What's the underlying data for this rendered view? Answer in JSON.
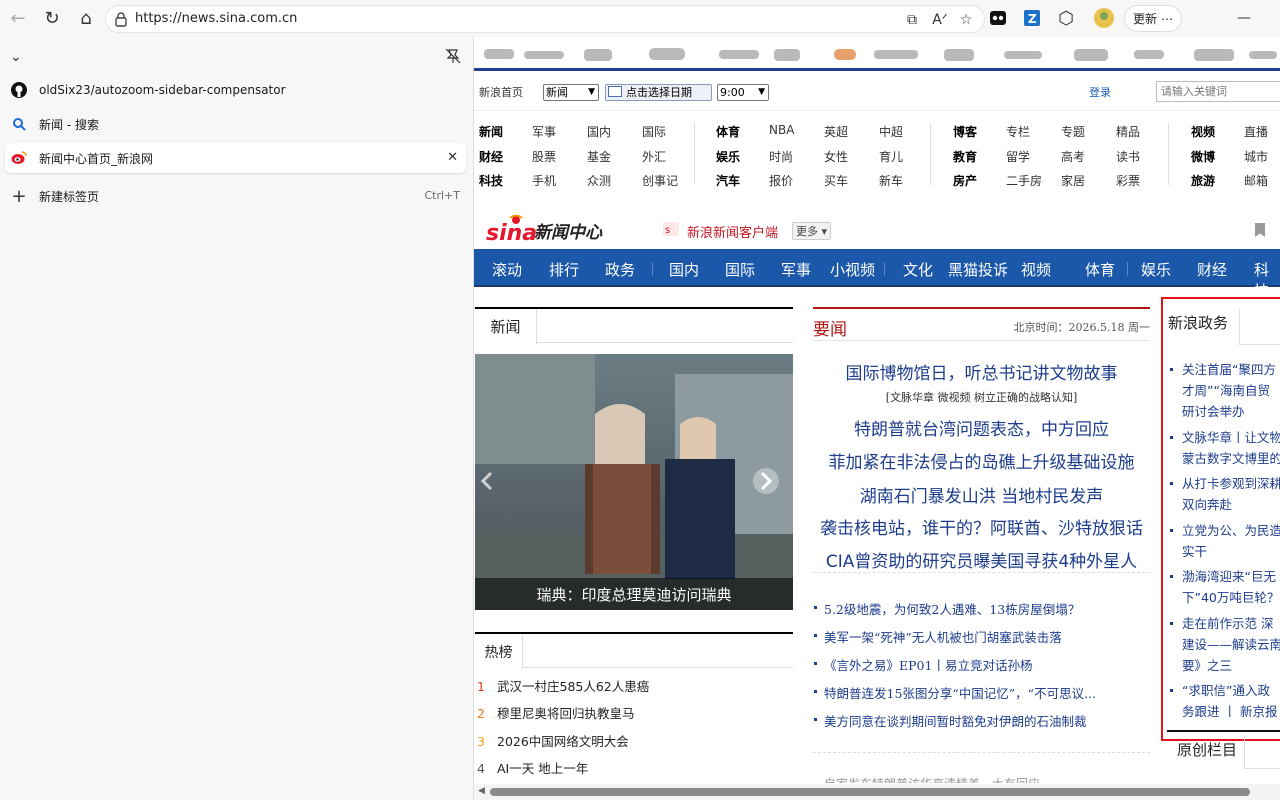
{
  "browser": {
    "url": "https://news.sina.com.cn",
    "update_label": "更新"
  },
  "sidebar": {
    "tabs": [
      {
        "title": "oldSix23/autozoom-sidebar-compensator",
        "icon": "github-icon"
      },
      {
        "title": "新闻 - 搜索",
        "icon": "search-icon"
      },
      {
        "title": "新闻中心首页_新浪网",
        "icon": "weibo-icon",
        "active": true
      },
      {
        "title": "新建标签页",
        "icon": "plus-icon",
        "shortcut": "Ctrl+T"
      }
    ]
  },
  "topbar": {
    "home_link": "新浪首页",
    "channel_select": "新闻",
    "date_placeholder": "点击选择日期",
    "time_select": "9:00",
    "login": "登录",
    "search_placeholder": "请输入关键词"
  },
  "nav": {
    "g1": [
      [
        "新闻",
        "军事",
        "国内",
        "国际"
      ],
      [
        "财经",
        "股票",
        "基金",
        "外汇"
      ],
      [
        "科技",
        "手机",
        "众测",
        "创事记"
      ]
    ],
    "g2": [
      [
        "体育",
        "NBA",
        "英超",
        "中超"
      ],
      [
        "娱乐",
        "时尚",
        "女性",
        "育儿"
      ],
      [
        "汽车",
        "报价",
        "买车",
        "新车"
      ]
    ],
    "g3": [
      [
        "博客",
        "专栏",
        "专题",
        "精品"
      ],
      [
        "教育",
        "留学",
        "高考",
        "读书"
      ],
      [
        "房产",
        "二手房",
        "家居",
        "彩票"
      ]
    ],
    "g4": [
      [
        "视频",
        "直播"
      ],
      [
        "微博",
        "城市"
      ],
      [
        "旅游",
        "邮箱"
      ]
    ]
  },
  "logo": {
    "brand": "sina",
    "title": "新闻中心"
  },
  "client_link": "新浪新闻客户端",
  "more_label": "更多",
  "channel_bar": [
    "滚动",
    "排行",
    "政务",
    "国内",
    "国际",
    "军事",
    "小视频",
    "文化",
    "黑猫投诉",
    "视频",
    "体育",
    "娱乐",
    "财经",
    "科技"
  ],
  "news_section": {
    "label": "新闻",
    "photo_caption": "瑞典：印度总理莫迪访问瑞典"
  },
  "hot": {
    "label": "热榜",
    "items": [
      {
        "rank": "1",
        "text": "武汉一村庄585人62人患癌",
        "color": "#e23c1c"
      },
      {
        "rank": "2",
        "text": "穆里尼奥将回归执教皇马",
        "color": "#f07a17"
      },
      {
        "rank": "3",
        "text": "2026中国网络文明大会",
        "color": "#f1a519"
      },
      {
        "rank": "4",
        "text": "AI一天 地上一年",
        "color": "#555555"
      }
    ]
  },
  "yaowen": {
    "label": "要闻",
    "time": "北京时间：2026.5.18 周一",
    "sub": "[文脉华章 微视频 树立正确的战略认知]",
    "headlines": [
      "国际博物馆日，听总书记讲文物故事",
      "特朗普就台湾问题表态，中方回应",
      "菲加紧在非法侵占的岛礁上升级基础设施",
      "湖南石门暴发山洪 当地村民发声",
      "袭击核电站，谁干的？阿联酋、沙特放狠话",
      "CIA曾资助的研究员曝美国寻获4种外星人"
    ],
    "bullets": [
      "5.2级地震，为何致2人遇难、13栋房屋倒塌？",
      "美军一架“死神”无人机被也门胡塞武装击落",
      "《言外之易》EP01丨易立竞对话孙杨",
      "特朗普连发15张图分享“中国记忆”，“不可思议...",
      "美方同意在谈判期间暂时豁免对伊朗的石油制裁"
    ],
    "cut_line": "自家发布特朗普访华高清精美…大有回应"
  },
  "gov": {
    "label": "新浪政务",
    "items": [
      [
        "关注首届“聚四方",
        "才周”“海南自贸",
        "研讨会举办"
      ],
      [
        "文脉华章丨让文物",
        "蒙古数字文博里的"
      ],
      [
        "从打卡参观到深耕",
        "双向奔赴"
      ],
      [
        "立党为公、为民造",
        "实干"
      ],
      [
        "渤海湾迎来“巨无",
        "下”40万吨巨轮？"
      ],
      [
        "走在前作示范 深",
        "建设——解读云南",
        "要》之三"
      ],
      [
        "“求职信”通入政",
        "务跟进 丨 新京报"
      ]
    ],
    "original_label": "原创栏目"
  }
}
